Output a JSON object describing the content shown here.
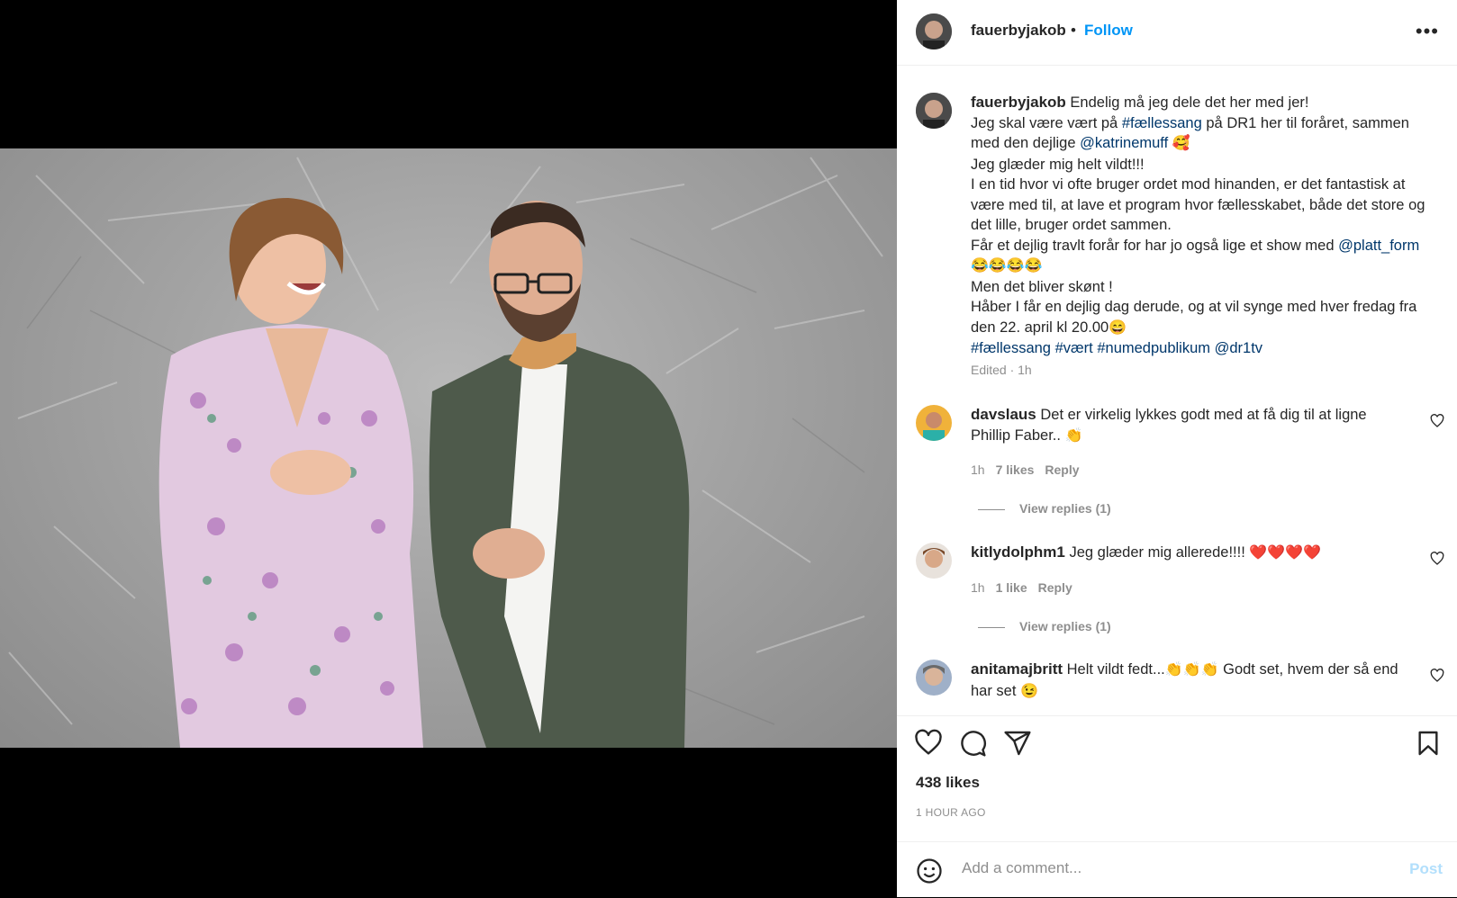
{
  "post": {
    "username": "fauerbyjakob",
    "separator": "•",
    "follow_label": "Follow",
    "more_label": "•••"
  },
  "caption": {
    "username": "fauerbyjakob",
    "line1": "Endelig må jeg dele det her med jer!",
    "line2a": "Jeg skal være vært på ",
    "hashtag1": "#fællessang",
    "line2b": " på DR1 her til foråret, sammen med den dejlige ",
    "mention1": "@katrinemuff",
    "emoji1": "🥰",
    "line3": "Jeg glæder mig helt vildt!!!",
    "line4": "I en tid hvor vi ofte bruger ordet mod hinanden, er det fantastisk at være med til, at lave et program hvor fællesskabet, både det store og det lille, bruger ordet sammen.",
    "line5a": "Får et dejlig travlt forår for har jo også lige et show med ",
    "mention2": "@platt_form",
    "emoji2": "😂😂😂😂",
    "line6": "Men det bliver skønt !",
    "line7": "Håber I får en dejlig dag derude, og at vil synge med hver fredag fra den 22. april kl 20.00",
    "emoji3": "😄",
    "tags": [
      "#fællessang",
      "#vært",
      "#numedpublikum",
      "@dr1tv"
    ],
    "edited": "Edited · 1h"
  },
  "comments": [
    {
      "username": "davslaus",
      "text": "Det er virkelig lykkes godt med at få dig til at ligne Phillip Faber.. ",
      "emoji": "👏",
      "time": "1h",
      "likes": "7 likes",
      "reply": "Reply",
      "view_replies": "View replies (1)"
    },
    {
      "username": "kitlydolphm1",
      "text": "Jeg glæder mig allerede!!!! ",
      "emoji": "❤️❤️❤️❤️",
      "time": "1h",
      "likes": "1 like",
      "reply": "Reply",
      "view_replies": "View replies (1)"
    },
    {
      "username": "anitamajbritt",
      "text": "Helt vildt fedt...",
      "emoji": "👏👏👏",
      "text2": " Godt set, hvem der så end har set ",
      "emoji2": "😉"
    }
  ],
  "footer": {
    "likes": "438 likes",
    "time_ago": "1 HOUR AGO",
    "comment_placeholder": "Add a comment...",
    "post_label": "Post"
  },
  "colors": {
    "link": "#00376b",
    "follow": "#0095f6",
    "post_disabled": "#b2dffc",
    "muted": "#8e8e8e"
  },
  "icons": [
    "like-icon",
    "comment-icon",
    "share-icon",
    "save-icon",
    "emoji-icon",
    "more-icon"
  ]
}
